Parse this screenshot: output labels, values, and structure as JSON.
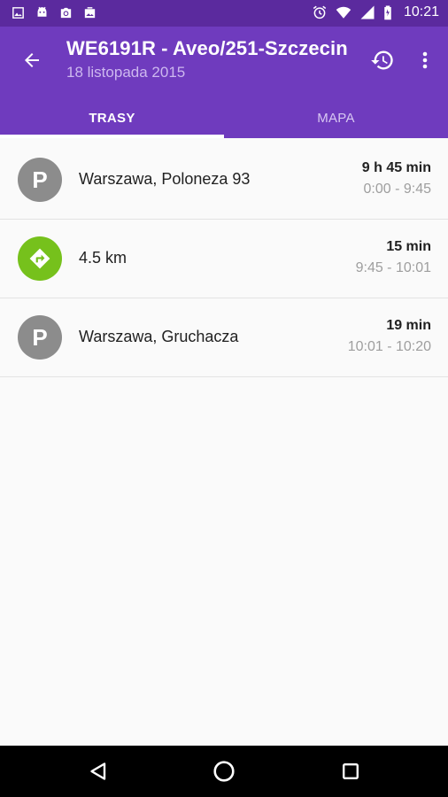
{
  "status_bar": {
    "time": "10:21",
    "left_icons": [
      "image-icon",
      "android-icon",
      "photo-icon",
      "photo-icon"
    ],
    "right_icons": [
      "alarm-icon",
      "wifi-icon",
      "signal-icon",
      "battery-icon"
    ]
  },
  "app_bar": {
    "title": "WE6191R - Aveo/251-Szczecin",
    "subtitle": "18 listopada 2015",
    "back_icon": "arrow-back-icon",
    "history_icon": "history-icon",
    "more_icon": "more-vert-icon",
    "background_color": "#6f3bbe"
  },
  "tabs": [
    {
      "label": "TRASY",
      "active": true
    },
    {
      "label": "MAPA",
      "active": false
    }
  ],
  "items": [
    {
      "type": "parking",
      "icon": "parking-icon",
      "icon_text": "P",
      "label": "Warszawa, Poloneza 93",
      "duration": "9 h 45 min",
      "time_range": "0:00 - 9:45",
      "icon_color": "#8c8c8c"
    },
    {
      "type": "route",
      "icon": "directions-icon",
      "label": "4.5 km",
      "duration": "15 min",
      "time_range": "9:45 - 10:01",
      "icon_color": "#76c11c"
    },
    {
      "type": "parking",
      "icon": "parking-icon",
      "icon_text": "P",
      "label": "Warszawa, Gruchacza",
      "duration": "19 min",
      "time_range": "10:01 - 10:20",
      "icon_color": "#8c8c8c"
    }
  ],
  "nav_bar": {
    "buttons": [
      "back-triangle-icon",
      "home-circle-icon",
      "recents-square-icon"
    ]
  }
}
